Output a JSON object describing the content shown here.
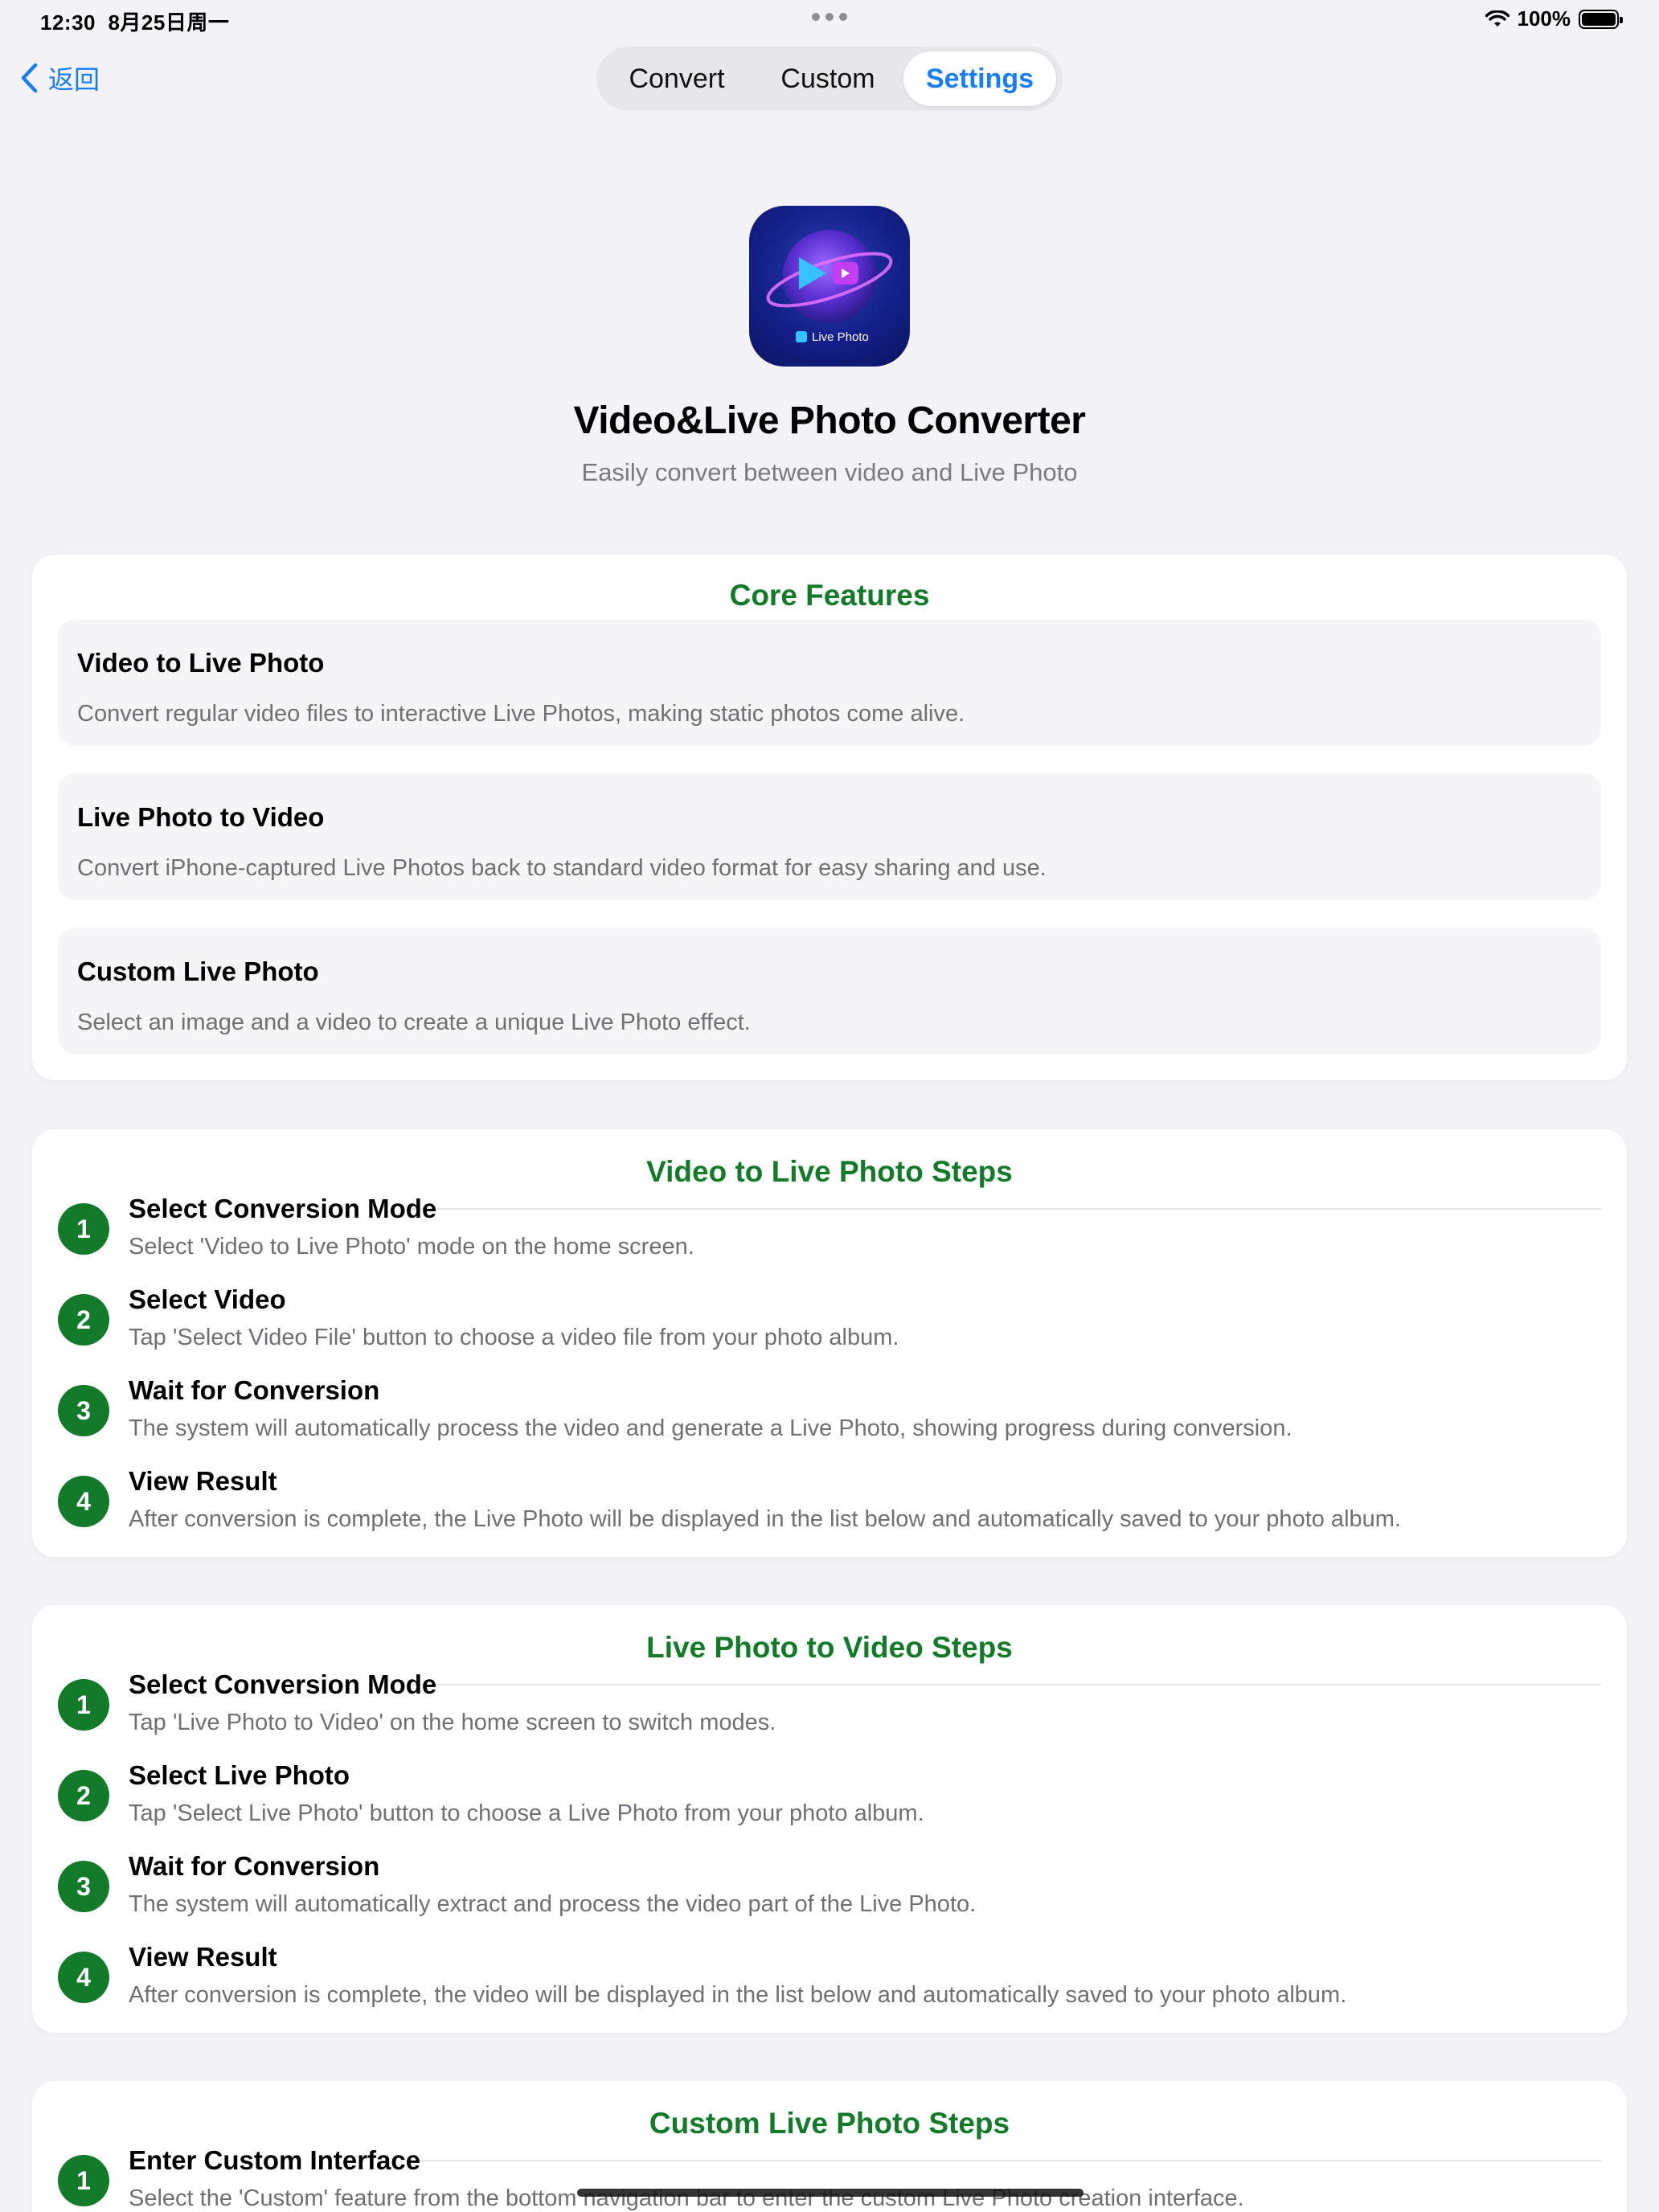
{
  "status": {
    "time": "12:30",
    "date": "8月25日周一",
    "battery": "100%"
  },
  "nav": {
    "back_label": "返回",
    "segments": [
      "Convert",
      "Custom",
      "Settings"
    ],
    "selected": "Settings"
  },
  "header": {
    "app_name": "Video&Live Photo Converter",
    "subtitle": "Easily convert between video and Live Photo",
    "icon_label": "Live Photo"
  },
  "features": {
    "title": "Core Features",
    "items": [
      {
        "title": "Video to Live Photo",
        "desc": "Convert regular video files to interactive Live Photos, making static photos come alive."
      },
      {
        "title": "Live Photo to Video",
        "desc": "Convert iPhone-captured Live Photos back to standard video format for easy sharing and use."
      },
      {
        "title": "Custom Live Photo",
        "desc": "Select an image and a video to create a unique Live Photo effect."
      }
    ]
  },
  "v2l": {
    "title": "Video to Live Photo Steps",
    "steps": [
      {
        "num": "1",
        "title": "Select Conversion Mode",
        "desc": "Select 'Video to Live Photo' mode on the home screen."
      },
      {
        "num": "2",
        "title": "Select Video",
        "desc": "Tap 'Select Video File' button to choose a video file from your photo album."
      },
      {
        "num": "3",
        "title": "Wait for Conversion",
        "desc": "The system will automatically process the video and generate a Live Photo, showing progress during conversion."
      },
      {
        "num": "4",
        "title": "View Result",
        "desc": "After conversion is complete, the Live Photo will be displayed in the list below and automatically saved to your photo album."
      }
    ]
  },
  "l2v": {
    "title": "Live Photo to Video Steps",
    "steps": [
      {
        "num": "1",
        "title": "Select Conversion Mode",
        "desc": "Tap 'Live Photo to Video' on the home screen to switch modes."
      },
      {
        "num": "2",
        "title": "Select Live Photo",
        "desc": "Tap 'Select Live Photo' button to choose a Live Photo from your photo album."
      },
      {
        "num": "3",
        "title": "Wait for Conversion",
        "desc": "The system will automatically extract and process the video part of the Live Photo."
      },
      {
        "num": "4",
        "title": "View Result",
        "desc": "After conversion is complete, the video will be displayed in the list below and automatically saved to your photo album."
      }
    ]
  },
  "custom": {
    "title": "Custom Live Photo Steps",
    "steps": [
      {
        "num": "1",
        "title": "Enter Custom Interface",
        "desc": "Select the 'Custom' feature from the bottom navigation bar to enter the custom Live Photo creation interface."
      }
    ]
  },
  "colors": {
    "accent_blue": "#1a7cf5",
    "section_green": "#137a2a",
    "background": "#f2f2f7"
  }
}
